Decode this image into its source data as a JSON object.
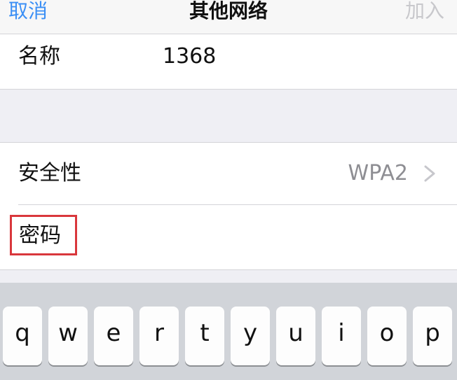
{
  "nav": {
    "cancel_label": "取消",
    "title": "其他网络",
    "join_label": "加入"
  },
  "network": {
    "name_label": "名称",
    "name_value": "1368"
  },
  "security": {
    "label": "安全性",
    "value": "WPA2"
  },
  "password": {
    "label": "密码",
    "value": ""
  },
  "keyboard": {
    "row1": [
      "q",
      "w",
      "e",
      "r",
      "t",
      "y",
      "u",
      "i",
      "o",
      "p"
    ]
  },
  "colors": {
    "accent": "#3b8ff5",
    "highlight_box": "#d9373c"
  }
}
